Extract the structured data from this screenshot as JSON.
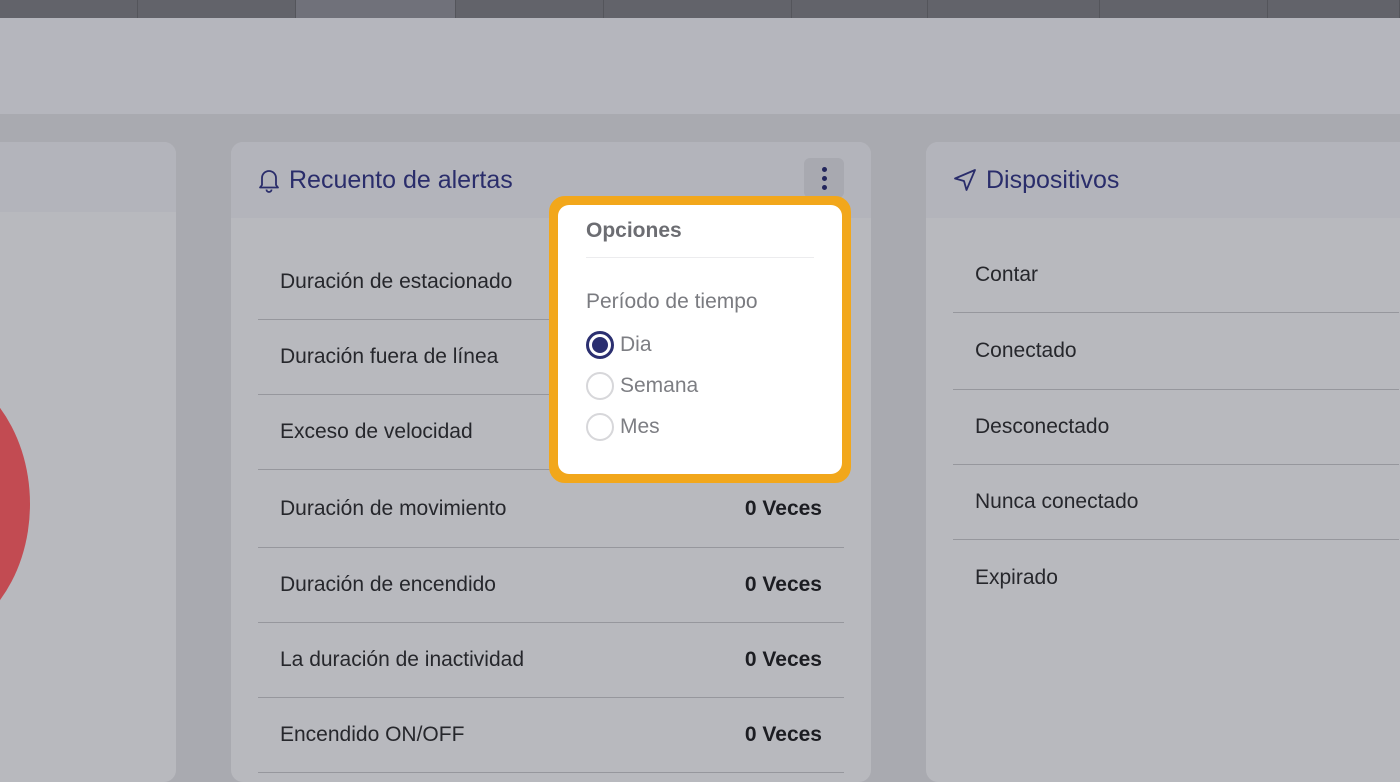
{
  "alerts_card": {
    "title": "Recuento de alertas",
    "rows": [
      {
        "label": "Duración de estacionado",
        "value": ""
      },
      {
        "label": "Duración fuera de línea",
        "value": ""
      },
      {
        "label": "Exceso de velocidad",
        "value": ""
      },
      {
        "label": "Duración de movimiento",
        "value": "0 Veces"
      },
      {
        "label": "Duración de encendido",
        "value": "0 Veces"
      },
      {
        "label": "La duración de inactividad",
        "value": "0 Veces"
      },
      {
        "label": "Encendido ON/OFF",
        "value": "0 Veces"
      }
    ]
  },
  "options_popup": {
    "title": "Opciones",
    "section_label": "Período de tiempo",
    "options": [
      {
        "label": "Dia",
        "checked": true
      },
      {
        "label": "Semana",
        "checked": false
      },
      {
        "label": "Mes",
        "checked": false
      }
    ]
  },
  "devices_card": {
    "title": "Dispositivos",
    "rows": [
      {
        "label": "Contar"
      },
      {
        "label": "Conectado"
      },
      {
        "label": "Desconectado"
      },
      {
        "label": "Nunca conectado"
      },
      {
        "label": "Expirado"
      }
    ]
  },
  "colors": {
    "accent_navy": "#2b2f70",
    "highlight_orange": "#f2a71b",
    "chart_red": "#c24b52"
  },
  "icons": {
    "alerts": "bell-icon",
    "devices": "navigation-arrow-icon",
    "menu": "kebab-menu-icon"
  }
}
